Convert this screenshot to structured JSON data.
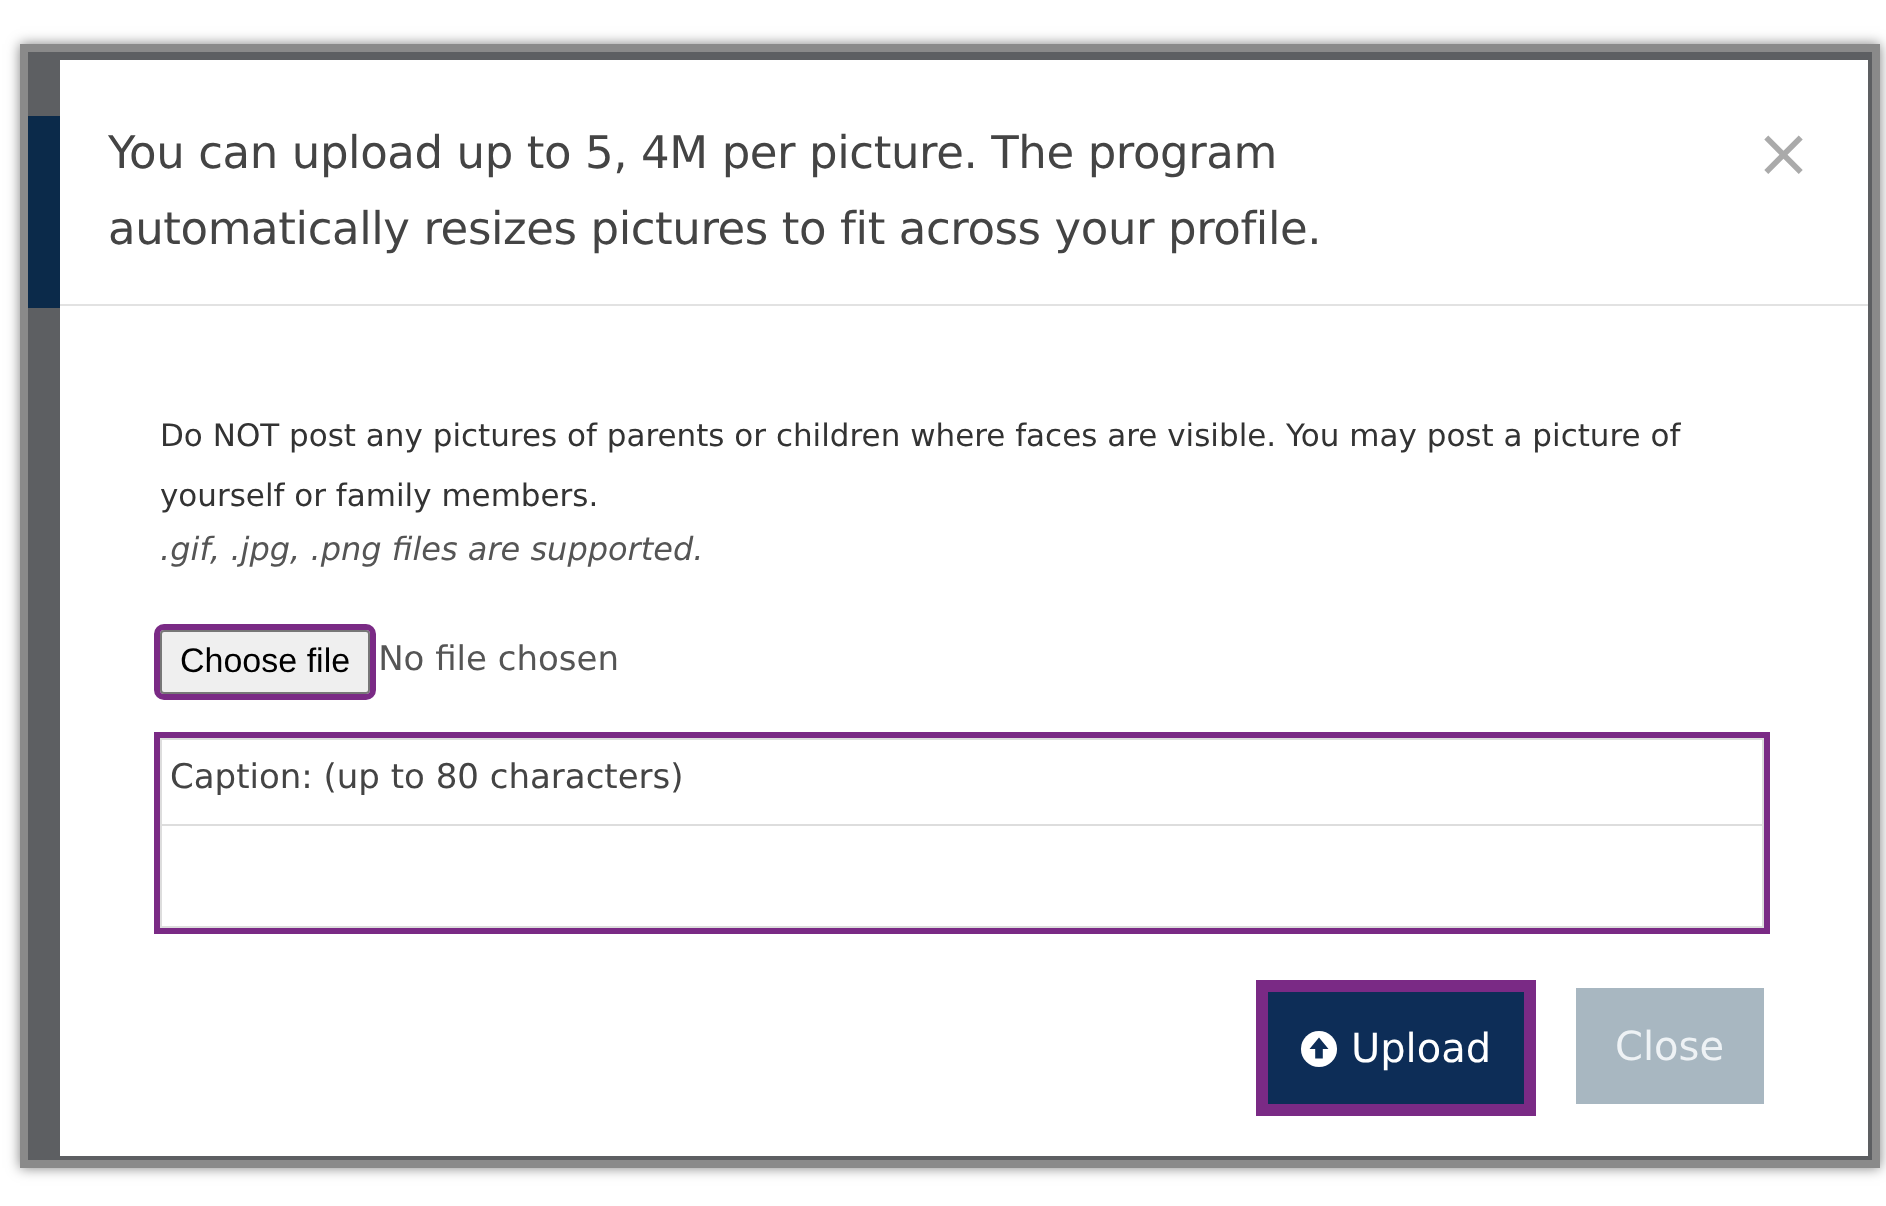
{
  "modal": {
    "title": "You can upload up to 5, 4M per picture. The program automatically resizes pictures to fit across your profile.",
    "close_glyph": "×",
    "notice": "Do NOT post any pictures of parents or children where faces are visible. You may post a picture of yourself or family members.",
    "formats": ".gif, .jpg, .png files are supported.",
    "file_input": {
      "button": "Choose file",
      "status": "No file chosen",
      "highlighted": true
    },
    "caption": {
      "label": "Caption: (up to 80 characters)",
      "highlighted": true
    },
    "buttons": [
      {
        "kind": "primary",
        "label": "Upload",
        "highlighted": true
      },
      {
        "kind": "secondary",
        "label": "Close",
        "highlighted": false
      }
    ]
  }
}
